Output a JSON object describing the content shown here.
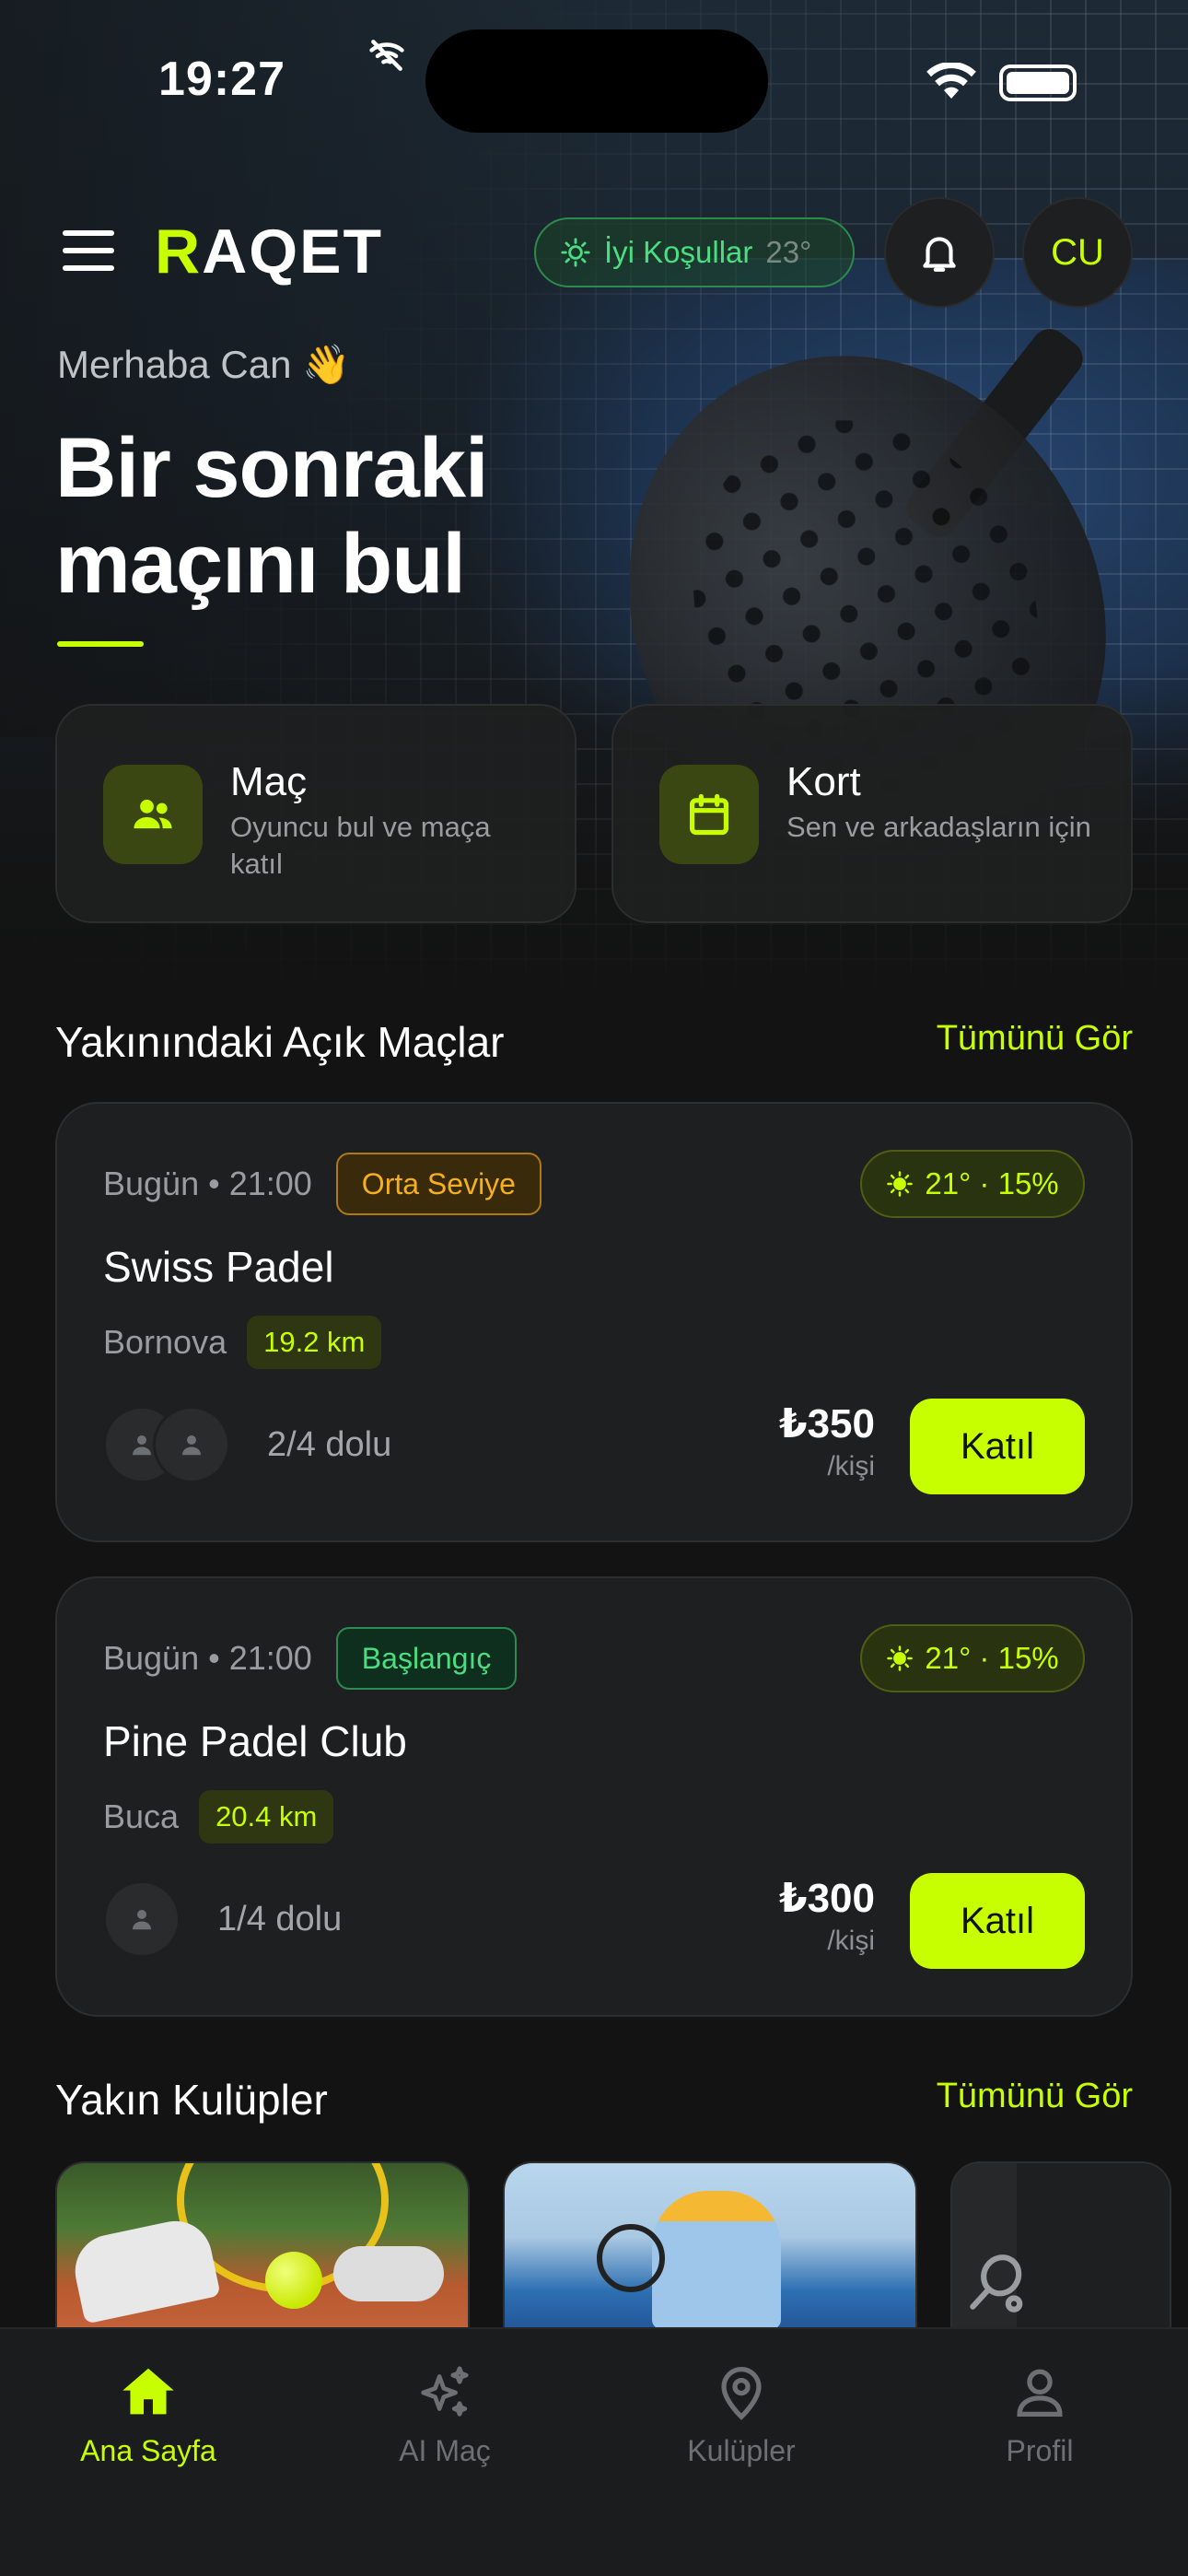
{
  "status_bar": {
    "time": "19:27"
  },
  "header": {
    "logo_first": "R",
    "logo_rest": "AQET",
    "weather_label": "İyi Koşullar",
    "weather_temp": "23°",
    "avatar_initials": "CU"
  },
  "hero": {
    "greeting": "Merhaba Can 👋",
    "headline_line1": "Bir sonraki",
    "headline_line2": "maçını bul"
  },
  "quick_actions": [
    {
      "title": "Maç",
      "subtitle": "Oyuncu bul ve maça katıl",
      "icon": "people-icon"
    },
    {
      "title": "Kort",
      "subtitle": "Sen ve arkadaşların için",
      "icon": "calendar-icon"
    }
  ],
  "open_matches": {
    "title": "Yakınındaki Açık Maçlar",
    "see_all": "Tümünü Gör",
    "items": [
      {
        "time": "Bugün • 21:00",
        "level": "Orta Seviye",
        "weather": "21° · 15%",
        "name": "Swiss Padel",
        "location": "Bornova",
        "distance": "19.2 km",
        "filled": "2/4 dolu",
        "price": "₺350",
        "per": "/kişi",
        "join": "Katıl"
      },
      {
        "time": "Bugün • 21:00",
        "level": "Başlangıç",
        "weather": "21° · 15%",
        "name": "Pine Padel Club",
        "location": "Buca",
        "distance": "20.4 km",
        "filled": "1/4 dolu",
        "price": "₺300",
        "per": "/kişi",
        "join": "Katıl"
      }
    ]
  },
  "nearby_clubs": {
    "title": "Yakın Kulüpler",
    "see_all": "Tümünü Gör"
  },
  "tabbar": [
    {
      "label": "Ana Sayfa",
      "icon": "home-icon",
      "active": true
    },
    {
      "label": "AI Maç",
      "icon": "sparkles-icon",
      "active": false
    },
    {
      "label": "Kulüpler",
      "icon": "location-pin-icon",
      "active": false
    },
    {
      "label": "Profil",
      "icon": "person-icon",
      "active": false
    }
  ],
  "colors": {
    "accent": "#c8ff00",
    "background": "#131313",
    "card": "#1e1f20",
    "success": "#4ade80",
    "warning": "#f5b01b"
  }
}
